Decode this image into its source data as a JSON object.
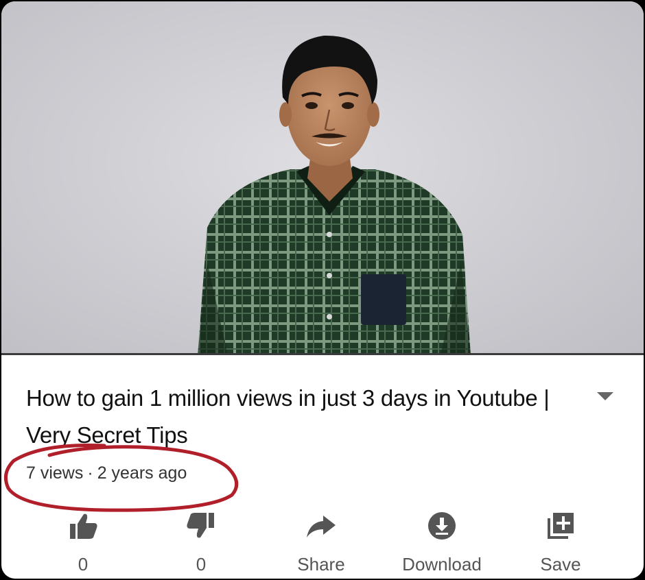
{
  "video": {
    "title": "How to gain 1 million views in just 3 days in Youtube | Very Secret Tips",
    "views": "7 views",
    "separator": "·",
    "age": "2 years ago"
  },
  "actions": {
    "like_count": "0",
    "dislike_count": "0",
    "share_label": "Share",
    "download_label": "Download",
    "save_label": "Save"
  },
  "icons": {
    "expand": "chevron-down-icon",
    "like": "thumbs-up-icon",
    "dislike": "thumbs-down-icon",
    "share": "share-arrow-icon",
    "download": "download-icon",
    "save": "add-to-playlist-icon"
  },
  "colors": {
    "annotation_circle": "#b01f2a",
    "icon_gray": "#555555",
    "text_dark": "#111111"
  }
}
